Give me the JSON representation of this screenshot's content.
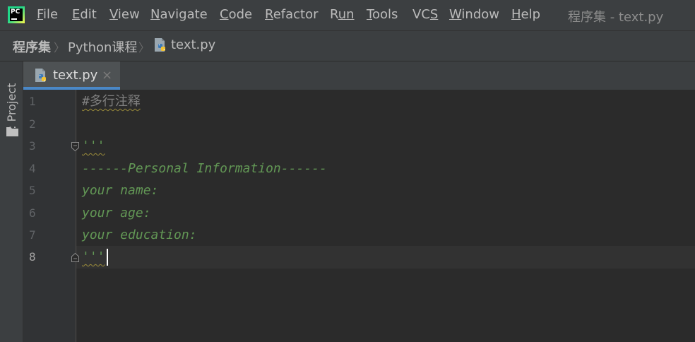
{
  "app": {
    "icon_text": "PC",
    "window_title": "程序集 - text.py"
  },
  "menu": [
    {
      "mnemonic": "F",
      "rest": "ile"
    },
    {
      "mnemonic": "E",
      "rest": "dit"
    },
    {
      "mnemonic": "V",
      "rest": "iew"
    },
    {
      "mnemonic": "N",
      "rest": "avigate"
    },
    {
      "mnemonic": "C",
      "rest": "ode"
    },
    {
      "mnemonic": "R",
      "rest": "efactor"
    },
    {
      "mnemonic": "R",
      "rest": "un",
      "pre": ""
    },
    {
      "mnemonic": "T",
      "rest": "ools"
    },
    {
      "pre": "VC",
      "mnemonic": "S",
      "rest": ""
    },
    {
      "mnemonic": "W",
      "rest": "indow"
    },
    {
      "mnemonic": "H",
      "rest": "elp"
    }
  ],
  "breadcrumb": {
    "root": "程序集",
    "folder": "Python课程",
    "file": "text.py",
    "separator": "〉"
  },
  "toolstrip": {
    "project_tab_label": "1: Project"
  },
  "tabs": [
    {
      "label": "text.py",
      "close": "×",
      "active": true
    }
  ],
  "editor": {
    "line_numbers": [
      "1",
      "2",
      "3",
      "4",
      "5",
      "6",
      "7",
      "8"
    ],
    "current_line": 8,
    "lines": {
      "l1": "#多行注释",
      "l3": "'''",
      "l4": "------Personal Information------",
      "l5": "your name:",
      "l6": "your age:",
      "l7": "your education:",
      "l8": "'''"
    }
  },
  "colors": {
    "menubar_bg": "#3c3f41",
    "editor_bg": "#2b2b2b",
    "comment": "#808080",
    "docstring": "#629755",
    "tab_underline": "#4a88c7"
  }
}
